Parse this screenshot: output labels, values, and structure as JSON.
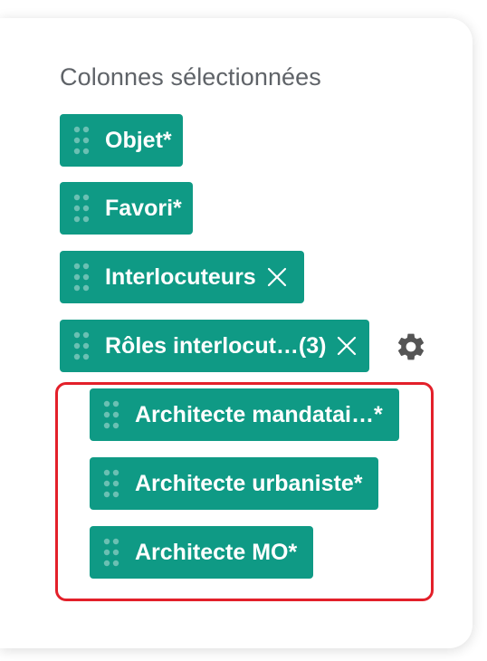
{
  "panel": {
    "title": "Colonnes sélectionnées"
  },
  "chips": [
    {
      "label": "Objet*",
      "removable": false
    },
    {
      "label": "Favori*",
      "removable": false
    },
    {
      "label": "Interlocuteurs",
      "removable": true
    },
    {
      "label": "Rôles interlocut…(3)",
      "removable": true
    }
  ],
  "sub_chips": [
    {
      "label": "Architecte mandatai…*"
    },
    {
      "label": "Architecte urbaniste*"
    },
    {
      "label": "Architecte MO*"
    }
  ],
  "icons": {
    "drag": "drag-handle-icon",
    "remove": "close-icon",
    "settings": "gear-icon"
  },
  "colors": {
    "chip_background": "#0f9a85",
    "highlight_border": "#e3202a",
    "title_text": "#5f6368"
  }
}
